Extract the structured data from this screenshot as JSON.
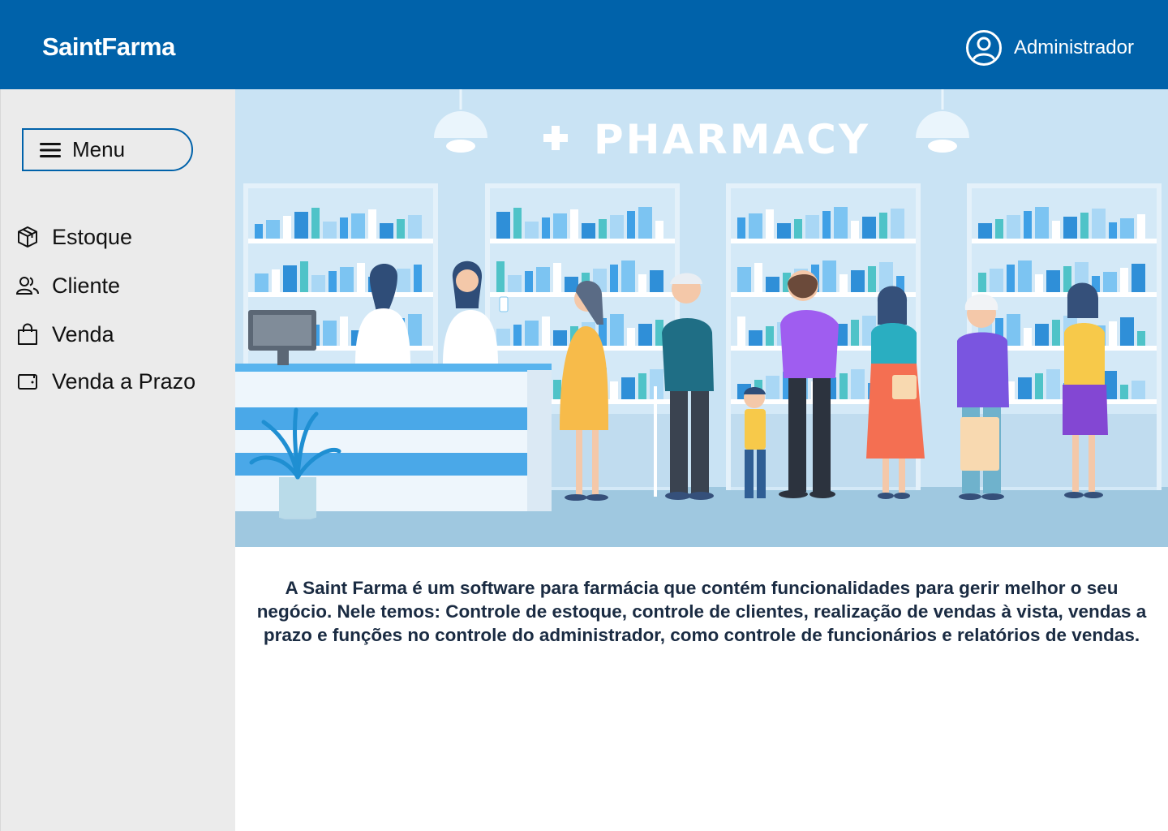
{
  "header": {
    "brand": "SaintFarma",
    "user_name": "Administrador",
    "user_icon": "user-circle-icon",
    "background_color": "#0062aa"
  },
  "sidebar": {
    "menu_label": "Menu",
    "menu_icon": "hamburger-icon",
    "items": [
      {
        "label": "Estoque",
        "icon": "box-icon"
      },
      {
        "label": "Cliente",
        "icon": "users-icon"
      },
      {
        "label": "Venda",
        "icon": "shopping-bag-icon"
      },
      {
        "label": "Venda a Prazo",
        "icon": "wallet-icon"
      }
    ]
  },
  "hero": {
    "sign_text": "PHARMACY"
  },
  "main": {
    "description": "A Saint Farma é um software para farmácia que contém funcionalidades para gerir melhor o seu negócio. Nele temos: Controle de estoque, controle de clientes, realização de vendas à vista, vendas a prazo e funções no controle do administrador, como controle de funcionários e relatórios de vendas."
  }
}
